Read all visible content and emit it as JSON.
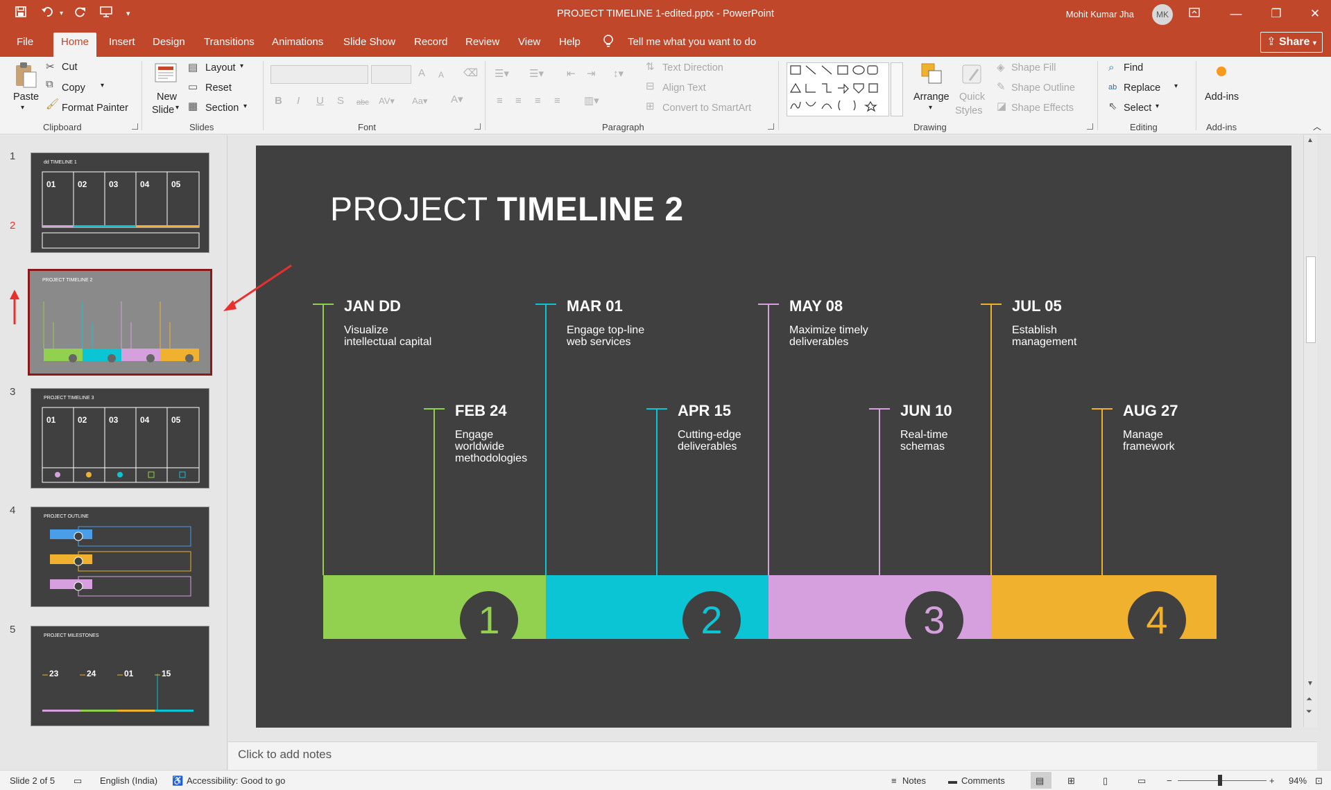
{
  "window": {
    "title": "PROJECT TIMELINE 1-edited.pptx  -  PowerPoint",
    "user_name": "Mohit Kumar Jha",
    "user_initials": "MK",
    "colors": {
      "titlebar": "#c0472a",
      "accent_red": "#e8312f"
    }
  },
  "quick_access": {
    "icons": [
      "save-icon",
      "undo-icon",
      "redo-icon",
      "present-icon",
      "customize-icon"
    ]
  },
  "tabs": [
    "File",
    "Home",
    "Insert",
    "Design",
    "Transitions",
    "Animations",
    "Slide Show",
    "Record",
    "Review",
    "View",
    "Help"
  ],
  "active_tab": "Home",
  "tell_me": "Tell me what you want to do",
  "share_label": "Share",
  "ribbon": {
    "clipboard": {
      "paste": "Paste",
      "cut": "Cut",
      "copy": "Copy",
      "format_painter": "Format Painter",
      "group": "Clipboard"
    },
    "slides": {
      "new_slide_1": "New",
      "new_slide_2": "Slide",
      "layout": "Layout",
      "reset": "Reset",
      "section": "Section",
      "group": "Slides"
    },
    "font": {
      "group": "Font"
    },
    "paragraph": {
      "text_direction": "Text Direction",
      "align_text": "Align Text",
      "convert_smartart": "Convert to SmartArt",
      "group": "Paragraph"
    },
    "drawing": {
      "arrange": "Arrange",
      "quick_styles_1": "Quick",
      "quick_styles_2": "Styles",
      "shape_fill": "Shape Fill",
      "shape_outline": "Shape Outline",
      "shape_effects": "Shape Effects",
      "group": "Drawing"
    },
    "editing": {
      "find": "Find",
      "replace": "Replace",
      "select": "Select",
      "group": "Editing"
    },
    "addins": {
      "label": "Add-ins",
      "group": "Add-ins"
    }
  },
  "thumbnails": [
    {
      "number": "1",
      "title": "dd TIMELINE 1"
    },
    {
      "number": "2",
      "title": "PROJECT TIMELINE 2"
    },
    {
      "number": "3",
      "title": "PROJECT TIMELINE 3"
    },
    {
      "number": "4",
      "title": "PROJECT OUTLINE"
    },
    {
      "number": "5",
      "title": "PROJECT MILESTONES"
    }
  ],
  "slide": {
    "title_light": "PROJECT ",
    "title_bold": "TIMELINE 2",
    "milestones": [
      {
        "date": "JAN DD",
        "desc": "Visualize intellectual capital",
        "color": "#92d050"
      },
      {
        "date": "FEB 24",
        "desc": "Engage worldwide methodologies",
        "color": "#92d050"
      },
      {
        "date": "MAR 01",
        "desc": "Engage top-line web services",
        "color": "#0bc5d5"
      },
      {
        "date": "APR 15",
        "desc": "Cutting-edge deliverables",
        "color": "#0bc5d5"
      },
      {
        "date": "MAY 08",
        "desc": "Maximize timely deliverables",
        "color": "#d6a0df"
      },
      {
        "date": "JUN 10",
        "desc": "Real-time schemas",
        "color": "#d6a0df"
      },
      {
        "date": "JUL 05",
        "desc": "Establish management",
        "color": "#f0b12e"
      },
      {
        "date": "AUG 27",
        "desc": "Manage framework",
        "color": "#f0b12e"
      }
    ],
    "phases": [
      {
        "number": "1",
        "color": "#92d050"
      },
      {
        "number": "2",
        "color": "#0bc5d5"
      },
      {
        "number": "3",
        "color": "#d6a0df"
      },
      {
        "number": "4",
        "color": "#f0b12e"
      }
    ]
  },
  "notes_placeholder": "Click to add notes",
  "status": {
    "slide": "Slide 2 of 5",
    "language": "English (India)",
    "accessibility": "Accessibility: Good to go",
    "notes": "Notes",
    "comments": "Comments",
    "zoom": "94%"
  }
}
